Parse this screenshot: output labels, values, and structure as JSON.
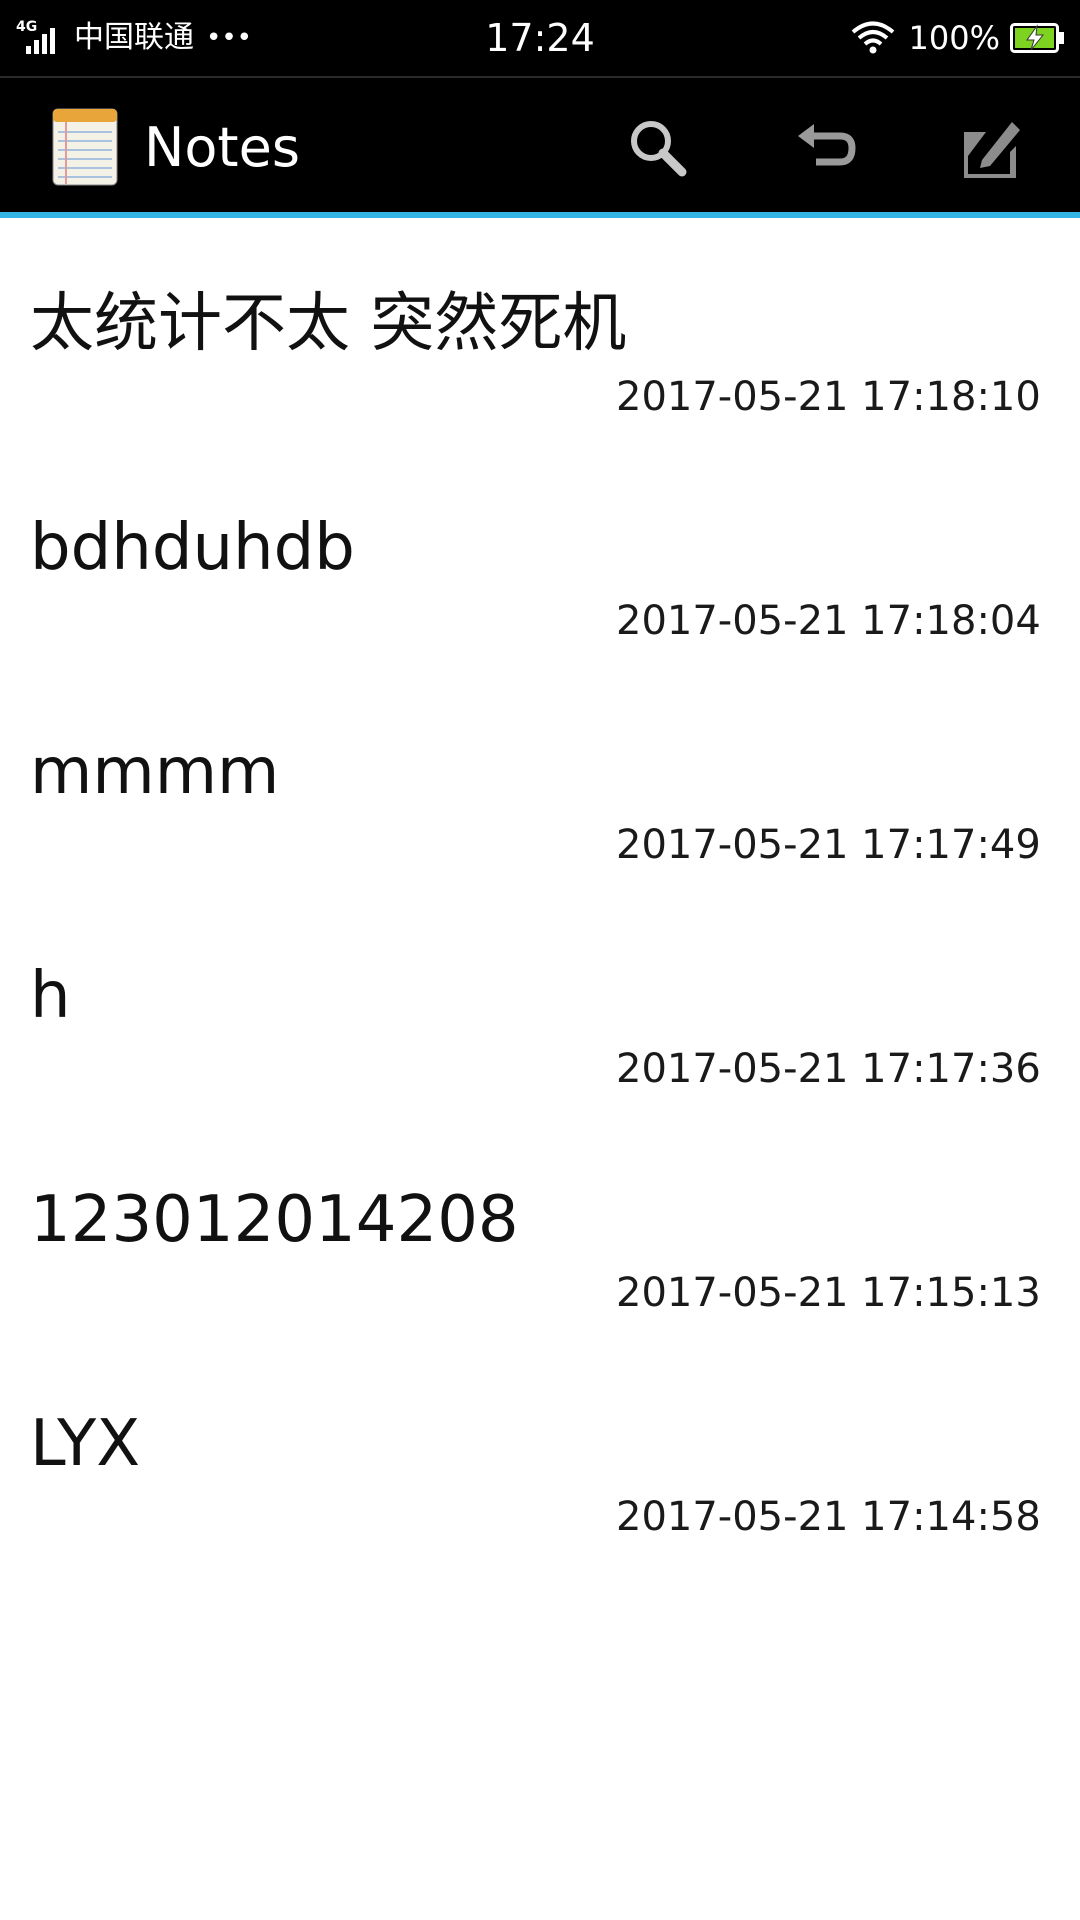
{
  "status_bar": {
    "network": "4G",
    "carrier": "中国联通",
    "more": "•••",
    "time": "17:24",
    "battery": "100%",
    "battery_color": "#7ed321"
  },
  "app_bar": {
    "title": "Notes",
    "logo_icon": "notepad-icon",
    "accent_color": "#33b5e5",
    "actions": [
      {
        "icon": "search-icon"
      },
      {
        "icon": "undo-icon"
      },
      {
        "icon": "compose-icon"
      }
    ]
  },
  "notes": [
    {
      "title": "太统计不太 突然死机",
      "time": "2017-05-21 17:18:10"
    },
    {
      "title": "bdhduhdb",
      "time": "2017-05-21 17:18:04"
    },
    {
      "title": "mmmm",
      "time": "2017-05-21 17:17:49"
    },
    {
      "title": "h",
      "time": "2017-05-21 17:17:36"
    },
    {
      "title": "123012014208",
      "time": "2017-05-21 17:15:13"
    },
    {
      "title": "LYX",
      "time": "2017-05-21 17:14:58"
    }
  ]
}
